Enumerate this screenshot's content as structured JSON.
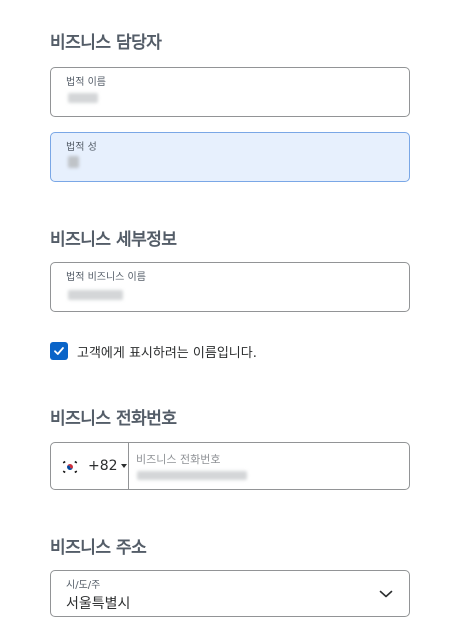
{
  "contact_section": {
    "title": "비즈니스 담당자",
    "legal_first_name_label": "법적 이름",
    "legal_last_name_label": "법적 성"
  },
  "details_section": {
    "title": "비즈니스 세부정보",
    "legal_business_name_label": "법적 비즈니스 이름",
    "display_name_checkbox": {
      "label": "고객에게 표시하려는 이름입니다.",
      "checked": true
    }
  },
  "phone_section": {
    "title": "비즈니스 전화번호",
    "country_code": "+82",
    "country_flag_icon": "south-korea-flag-icon",
    "phone_label": "비즈니스 전화번호"
  },
  "address_section": {
    "title": "비즈니스 주소",
    "state_label": "시/도/주",
    "state_value": "서울특별시"
  },
  "colors": {
    "accent": "#0a64c8",
    "active_field_bg": "#e7f0fd",
    "title": "#545d68"
  }
}
